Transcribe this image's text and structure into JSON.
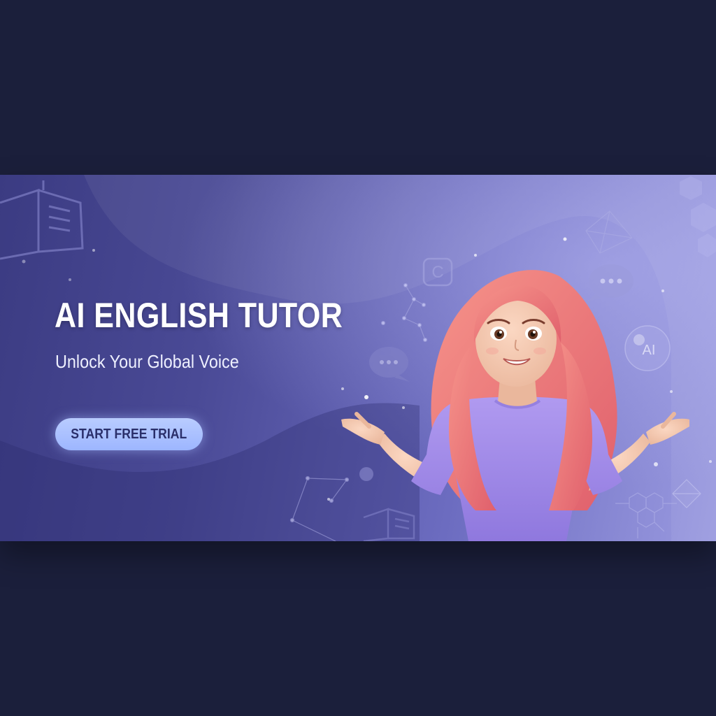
{
  "banner": {
    "title": "AI ENGLISH TUTOR",
    "subtitle": "Unlock Your Global Voice",
    "cta_label": "START FREE TRIAL",
    "bubble_ai_label": "AI",
    "c_icon_label": "C"
  },
  "colors": {
    "page_bg": "#1b1f3b",
    "banner_start": "#3b3b82",
    "banner_end": "#9a9ae0",
    "cta_bg": "#a9c0ff",
    "cta_text": "#2a2f6a",
    "hair": "#f07a7a",
    "shirt": "#a68ee8"
  },
  "icons": [
    "open-book-icon",
    "chat-bubble-icon",
    "c-letter-icon",
    "ai-orb-icon",
    "hexagon-icon",
    "network-constellation-icon",
    "circuit-icon",
    "crystal-icon"
  ]
}
